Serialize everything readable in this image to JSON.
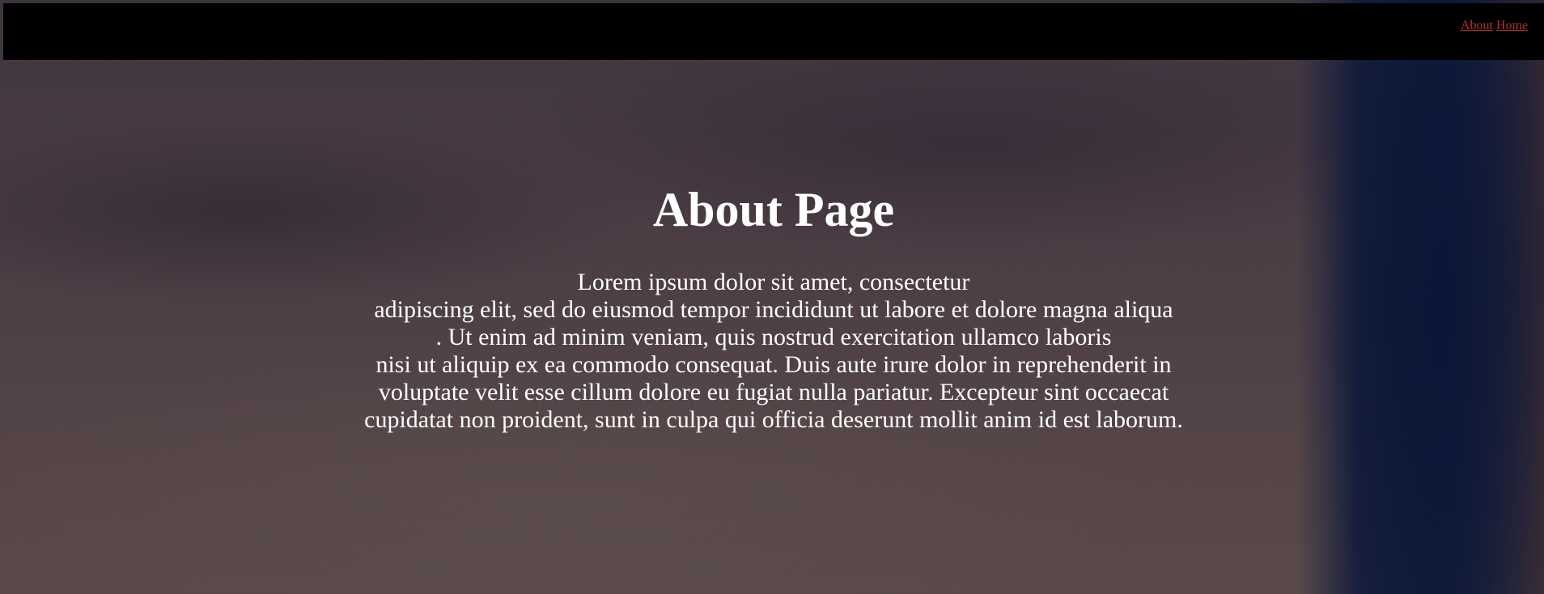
{
  "nav": {
    "links": [
      {
        "label": "About"
      },
      {
        "label": "Home"
      }
    ],
    "link_color": "#b3312f",
    "bar_color": "#000000"
  },
  "main": {
    "title": "About Page",
    "paragraph_lines": [
      "Lorem ipsum dolor sit amet, consectetur",
      "adipiscing elit, sed do eiusmod tempor incididunt ut labore et dolore magna aliqua",
      ". Ut enim ad minim veniam, quis nostrud exercitation ullamco laboris",
      "nisi ut aliquip ex ea commodo consequat. Duis aute irure dolor in reprehenderit in",
      "voluptate velit esse cillum dolore eu fugiat nulla pariatur. Excepteur sint occaecat",
      "cupidatat non proident, sunt in culpa qui officia deserunt mollit anim id est laborum."
    ],
    "text_color": "#ffffff"
  }
}
